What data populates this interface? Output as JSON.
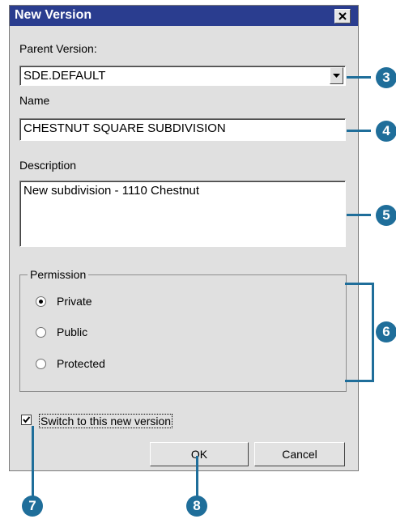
{
  "window": {
    "title": "New Version",
    "close_icon": "close-icon"
  },
  "form": {
    "parent_version_label": "Parent Version:",
    "parent_version_value": "SDE.DEFAULT",
    "name_label": "Name",
    "name_value": "CHESTNUT SQUARE SUBDIVISION",
    "description_label": "Description",
    "description_value": "New subdivision - 1110 Chestnut"
  },
  "permission": {
    "legend": "Permission",
    "options": [
      {
        "label": "Private",
        "selected": true
      },
      {
        "label": "Public",
        "selected": false
      },
      {
        "label": "Protected",
        "selected": false
      }
    ]
  },
  "switch_checkbox": {
    "label": "Switch to this new version",
    "checked": true
  },
  "buttons": {
    "ok": "OK",
    "cancel": "Cancel"
  },
  "callouts": [
    "3",
    "4",
    "5",
    "6",
    "7",
    "8"
  ],
  "colors": {
    "titlebar": "#2a3d8f",
    "callout": "#1f6e9a",
    "dialog_bg": "#e0e0e0"
  }
}
